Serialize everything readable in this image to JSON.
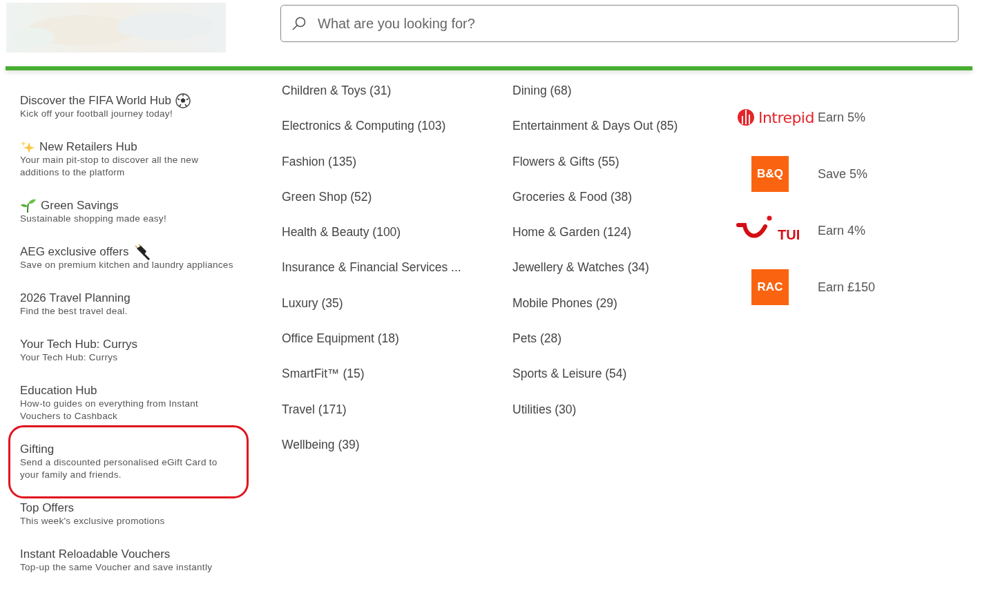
{
  "header": {
    "search": {
      "placeholder": "What are you looking for?"
    }
  },
  "sidebar": {
    "items": [
      {
        "title": "Discover the FIFA World Hub",
        "subtitle": "Kick off your football journey today!",
        "highlighted": false
      },
      {
        "title": "New Retailers Hub",
        "subtitle": "Your main pit-stop to discover all the new additions to the platform",
        "highlighted": false
      },
      {
        "title": "Green Savings",
        "subtitle": "Sustainable shopping made easy!",
        "highlighted": false
      },
      {
        "title": "AEG exclusive offers",
        "subtitle": "Save on premium kitchen and laundry appliances",
        "highlighted": false
      },
      {
        "title": "2026 Travel Planning",
        "subtitle": "Find the best travel deal.",
        "highlighted": false
      },
      {
        "title": "Your Tech Hub: Currys",
        "subtitle": "Your Tech Hub: Currys",
        "highlighted": false
      },
      {
        "title": "Education Hub",
        "subtitle": "How-to guides on everything from Instant Vouchers to Cashback",
        "highlighted": false
      },
      {
        "title": "Gifting",
        "subtitle": "Send a discounted personalised eGift Card to your family and friends.",
        "highlighted": true
      },
      {
        "title": "Top Offers",
        "subtitle": "This week's exclusive promotions",
        "highlighted": false
      },
      {
        "title": "Instant Reloadable Vouchers",
        "subtitle": "Top-up the same Voucher and save instantly",
        "highlighted": false
      }
    ]
  },
  "categories": {
    "column_1": [
      "Children & Toys (31)",
      "Electronics & Computing (103)",
      "Fashion (135)",
      "Green Shop (52)",
      "Health & Beauty (100)",
      "Insurance & Financial Services ...",
      "Luxury (35)",
      "Office Equipment (18)",
      "SmartFit™ (15)",
      "Travel (171)",
      "Wellbeing (39)"
    ],
    "column_2": [
      "Dining (68)",
      "Entertainment & Days Out (85)",
      "Flowers & Gifts (55)",
      "Groceries & Food (38)",
      "Home & Garden (124)",
      "Jewellery & Watches (34)",
      "Mobile Phones (29)",
      "Pets (28)",
      "Sports & Leisure (54)",
      "Utilities (30)"
    ]
  },
  "brands": [
    {
      "kind": "wordmark",
      "logo_text": "Intrepid",
      "offer": "Earn 5%"
    },
    {
      "kind": "tile",
      "logo_text": "B&Q",
      "offer": "Save 5%"
    },
    {
      "kind": "smile",
      "logo_text": "TUI",
      "offer": "Earn 4%"
    },
    {
      "kind": "tile",
      "logo_text": "RAC",
      "offer": "Earn £150"
    }
  ]
}
